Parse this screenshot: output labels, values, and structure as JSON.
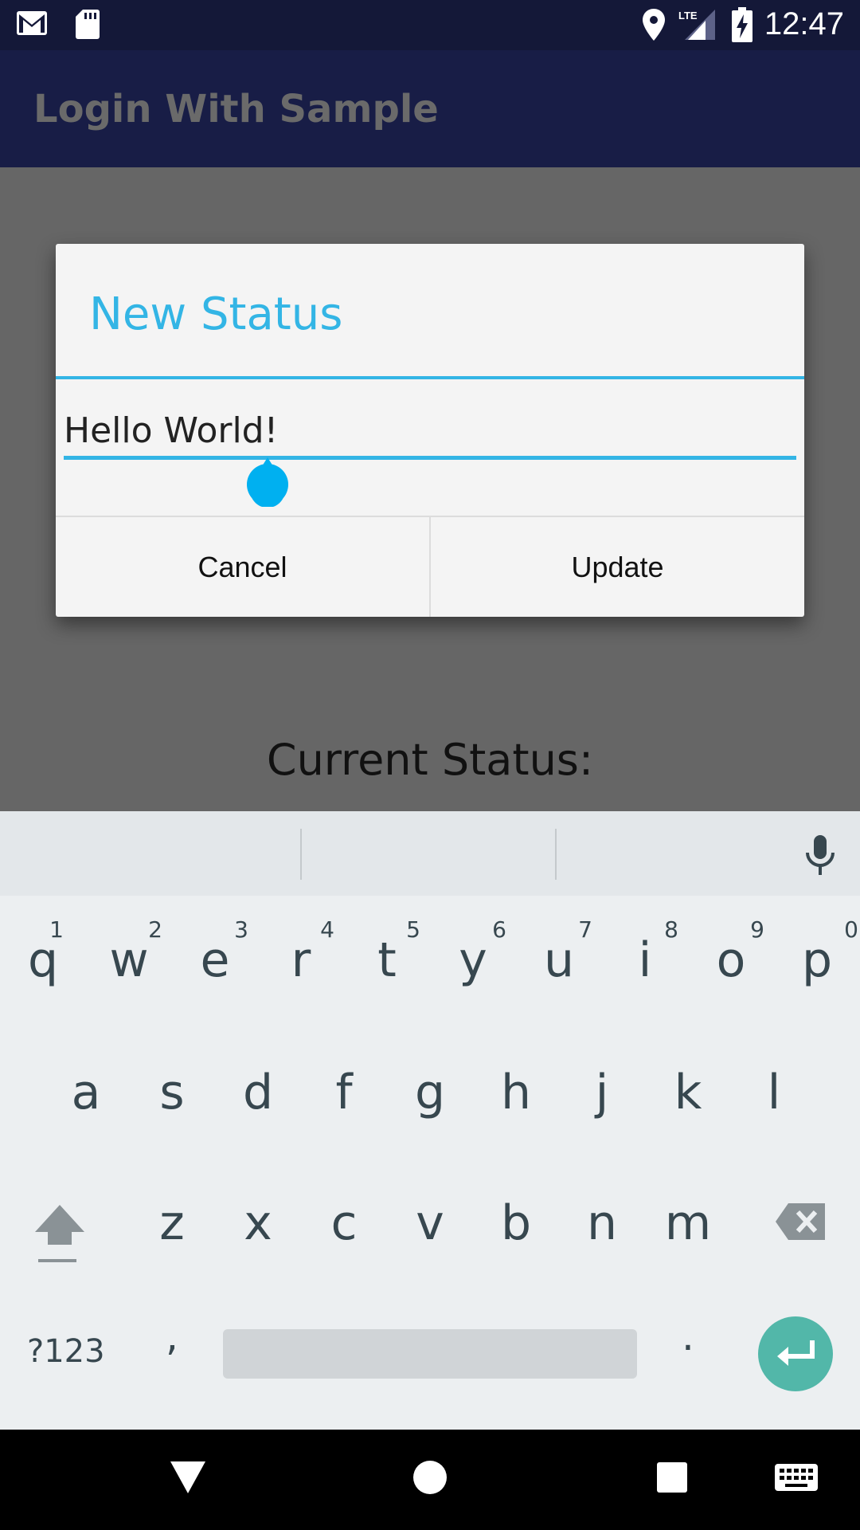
{
  "status_bar": {
    "time": "12:47",
    "icons": [
      "gmail-icon",
      "sd-card-icon",
      "location-icon",
      "lte-signal-icon",
      "battery-charging-icon"
    ]
  },
  "app_bar": {
    "title": "Login With Sample"
  },
  "content": {
    "current_status_label": "Current Status:"
  },
  "dialog": {
    "title": "New Status",
    "input_value": "Hello World!",
    "cancel_label": "Cancel",
    "update_label": "Update"
  },
  "keyboard": {
    "row1": [
      {
        "key": "q",
        "hint": "1"
      },
      {
        "key": "w",
        "hint": "2"
      },
      {
        "key": "e",
        "hint": "3"
      },
      {
        "key": "r",
        "hint": "4"
      },
      {
        "key": "t",
        "hint": "5"
      },
      {
        "key": "y",
        "hint": "6"
      },
      {
        "key": "u",
        "hint": "7"
      },
      {
        "key": "i",
        "hint": "8"
      },
      {
        "key": "o",
        "hint": "9"
      },
      {
        "key": "p",
        "hint": "0"
      }
    ],
    "row2": [
      "a",
      "s",
      "d",
      "f",
      "g",
      "h",
      "j",
      "k",
      "l"
    ],
    "row3": [
      "z",
      "x",
      "c",
      "v",
      "b",
      "n",
      "m"
    ],
    "symbols_label": "?123",
    "comma": ",",
    "period": "."
  },
  "colors": {
    "accent": "#33b5e5",
    "app_bar": "#181d46",
    "status_bar": "#141838",
    "enter_key": "#52b7a9"
  }
}
